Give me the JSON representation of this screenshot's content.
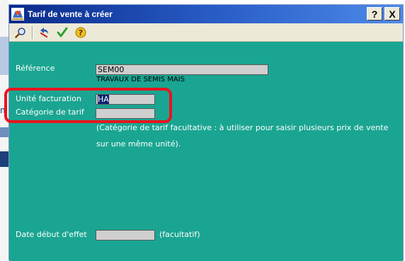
{
  "window": {
    "title": "Tarif de vente à créer",
    "help_label": "?",
    "close_label": "X"
  },
  "toolbar": {
    "icons": [
      "search-icon",
      "undo-icon",
      "checkmark-icon",
      "help-icon"
    ]
  },
  "form": {
    "reference": {
      "label": "Référence",
      "value": "SEM00",
      "description": "TRAVAUX DE SEMIS MAIS"
    },
    "unite": {
      "label": "Unité facturation",
      "value": "HA"
    },
    "categorie": {
      "label": "Catégorie de tarif",
      "value": "",
      "note_line1": "(Catégorie de tarif facultative : à utiliser pour saisir plusieurs prix de vente",
      "note_line2": "sur une même unité)."
    },
    "date": {
      "label": "Date début d'effet",
      "value": "",
      "note": "(facultatif)"
    }
  },
  "background": {
    "partial_letter": "n"
  },
  "colors": {
    "panel": "#1aa592",
    "titlebar": "#0a2a8a",
    "highlight": "#e8141e"
  }
}
